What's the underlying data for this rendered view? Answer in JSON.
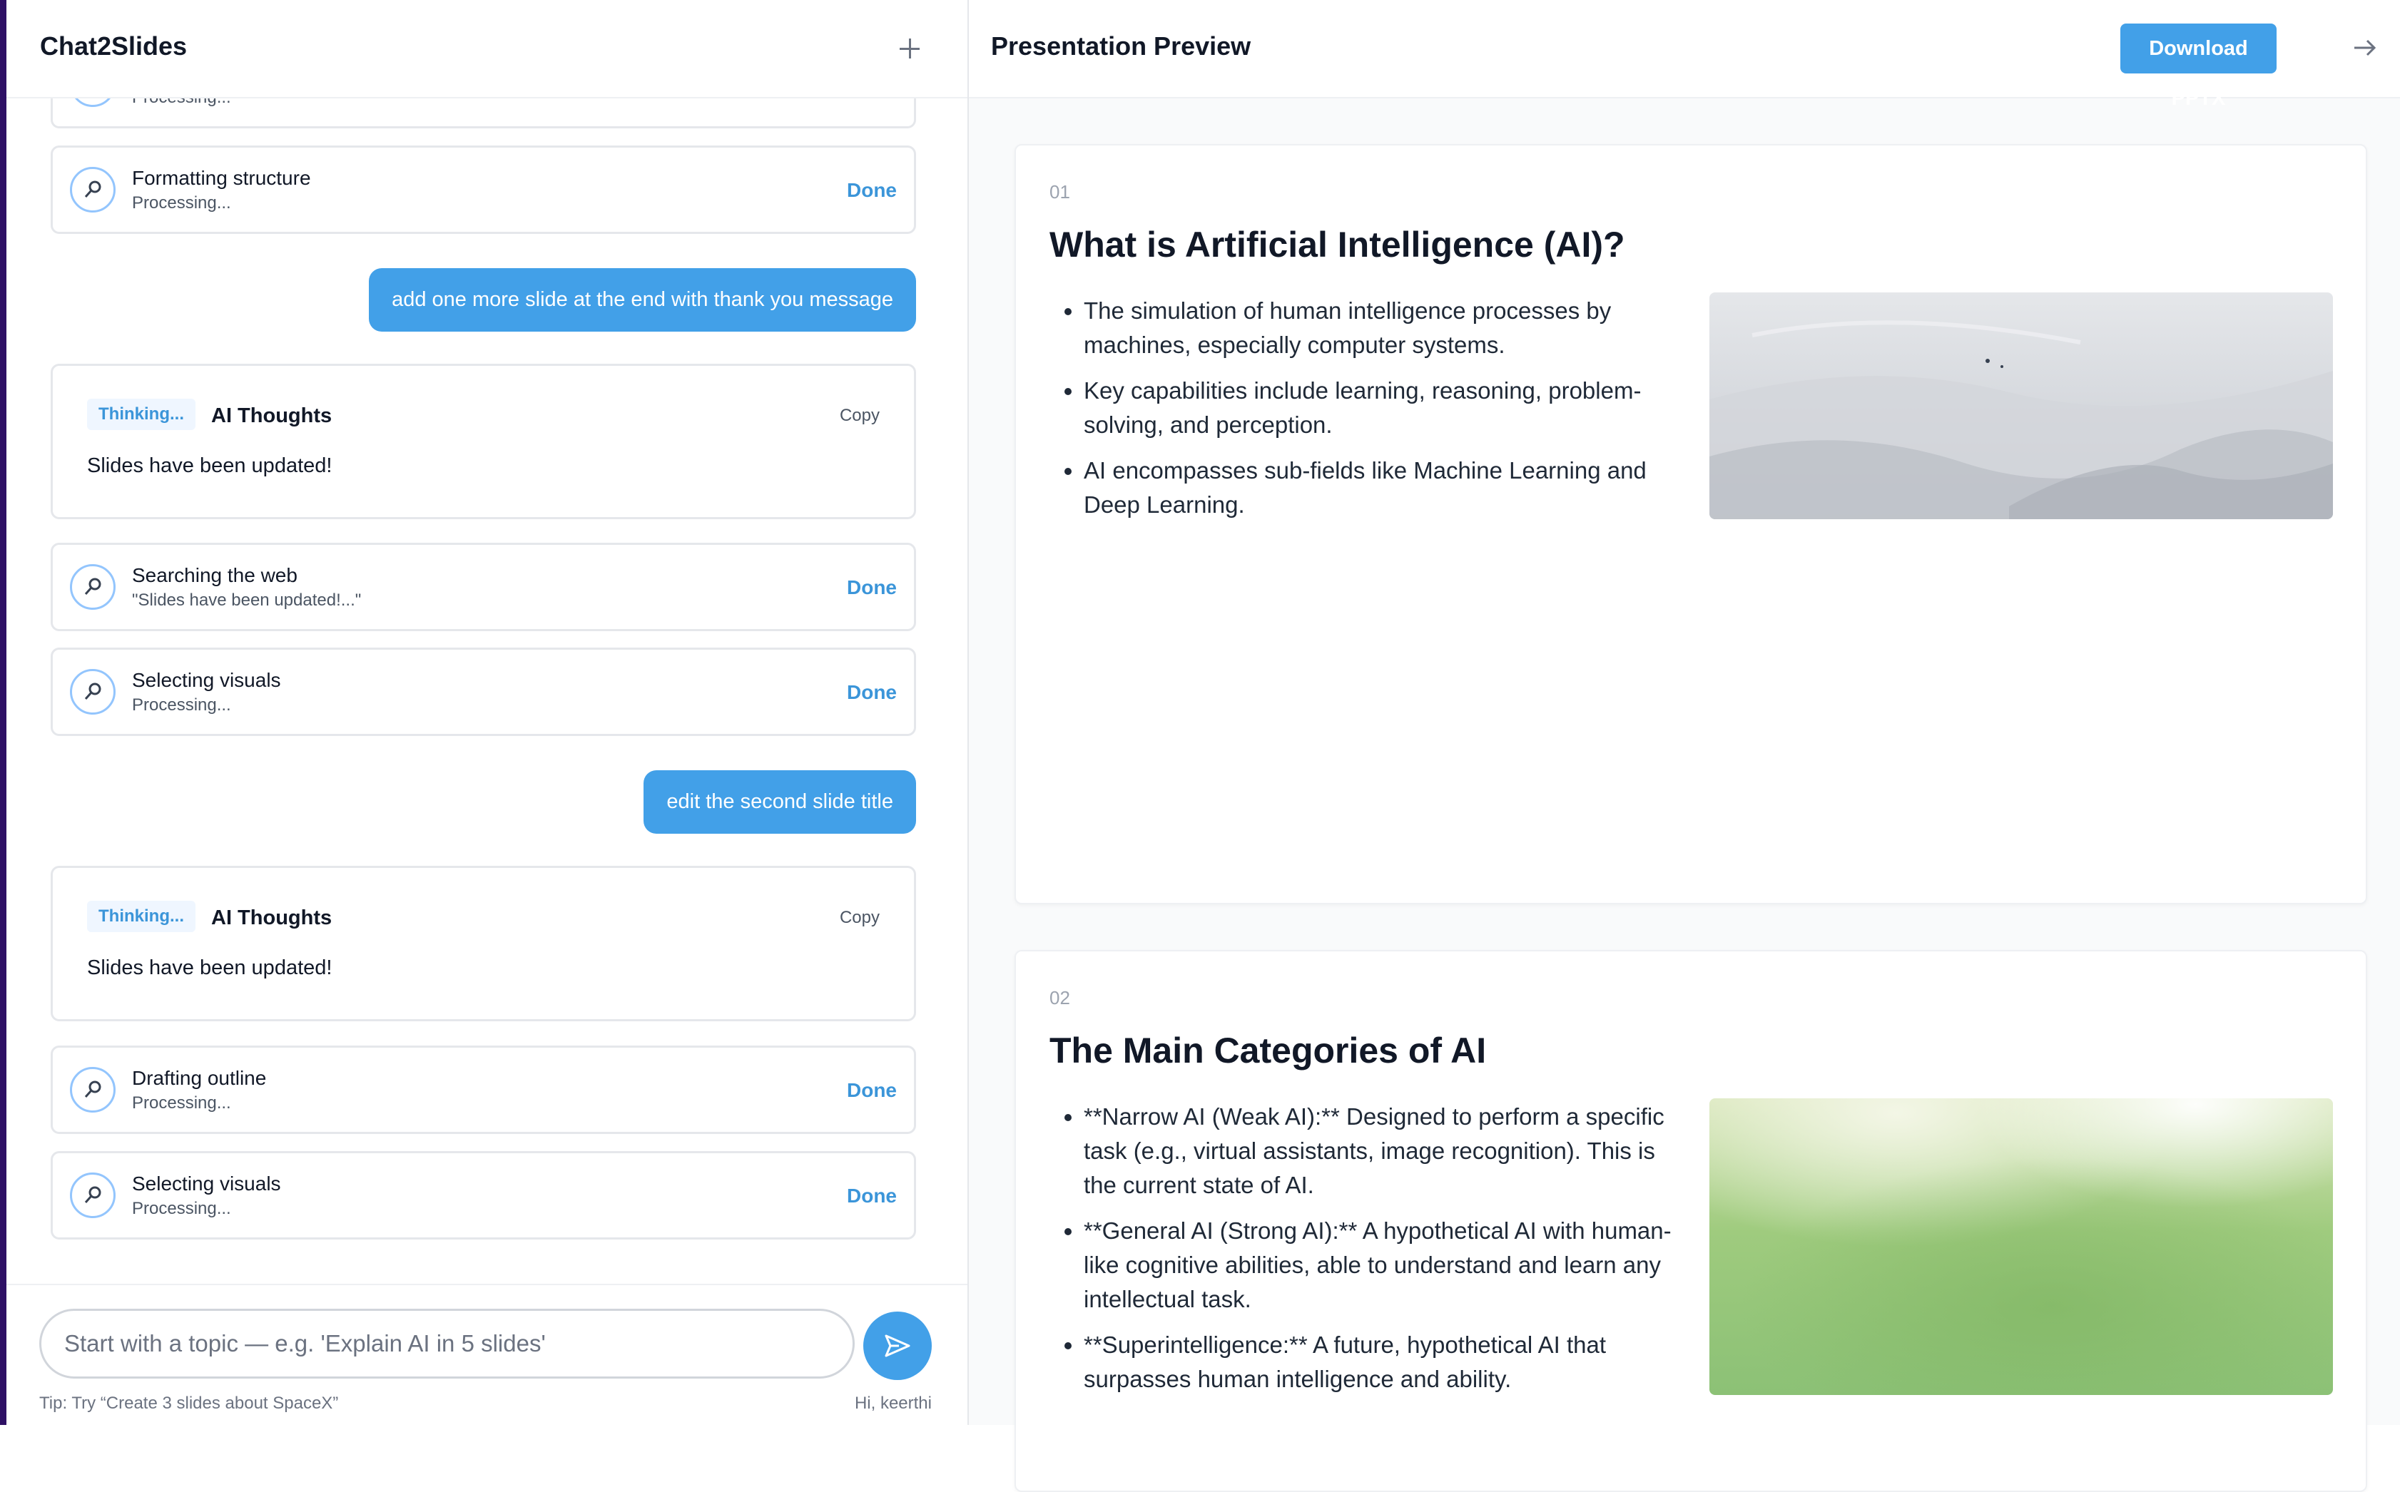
{
  "chat": {
    "title": "Chat2Slides",
    "steps": [
      {
        "title": "",
        "sub": "Processing...",
        "status": ""
      },
      {
        "title": "Formatting structure",
        "sub": "Processing...",
        "status": "Done"
      },
      {
        "title": "Searching the web",
        "sub": "\"Slides have been updated!...\"",
        "status": "Done"
      },
      {
        "title": "Selecting visuals",
        "sub": "Processing...",
        "status": "Done"
      },
      {
        "title": "Drafting outline",
        "sub": "Processing...",
        "status": "Done"
      },
      {
        "title": "Selecting visuals",
        "sub": "Processing...",
        "status": "Done"
      }
    ],
    "user_messages": [
      "add one more slide at the end with thank you message",
      "edit the second slide title"
    ],
    "thoughts": [
      {
        "badge": "Thinking...",
        "title": "AI Thoughts",
        "copy": "Copy",
        "text": "Slides have been updated!"
      },
      {
        "badge": "Thinking...",
        "title": "AI Thoughts",
        "copy": "Copy",
        "text": "Slides have been updated!"
      }
    ],
    "input_placeholder": "Start with a topic — e.g. 'Explain AI in 5 slides'",
    "tip": "Tip: Try “Create 3 slides about SpaceX”",
    "greeting": "Hi, keerthi",
    "icons": {
      "new_chat": "plus-icon",
      "step": "search-icon",
      "send": "send-icon"
    }
  },
  "preview": {
    "title": "Presentation Preview",
    "download_label": "Download PPTX",
    "collapse_icon": "arrow-right-icon",
    "slides": [
      {
        "number": "01",
        "title": "What is Artificial Intelligence (AI)?",
        "bullets": [
          "The simulation of human intelligence processes by machines, especially computer systems.",
          "Key capabilities include learning, reasoning, problem-solving, and perception.",
          "AI encompasses sub-fields like Machine Learning and Deep Learning."
        ],
        "image": "snow-landscape-photo"
      },
      {
        "number": "02",
        "title": "The Main Categories of AI",
        "bullets": [
          "**Narrow AI (Weak AI):** Designed to perform a specific task (e.g., virtual assistants, image recognition). This is the current state of AI.",
          "**General AI (Strong AI):** A hypothetical AI with human-like cognitive abilities, able to understand and learn any intellectual task.",
          "**Superintelligence:** A future, hypothetical AI that surpasses human intelligence and ability."
        ],
        "image": "blurred-green-photo"
      }
    ]
  },
  "colors": {
    "accent": "#42a0e8",
    "done": "#3b95d9",
    "sidebar_strip": "#2e1065"
  }
}
